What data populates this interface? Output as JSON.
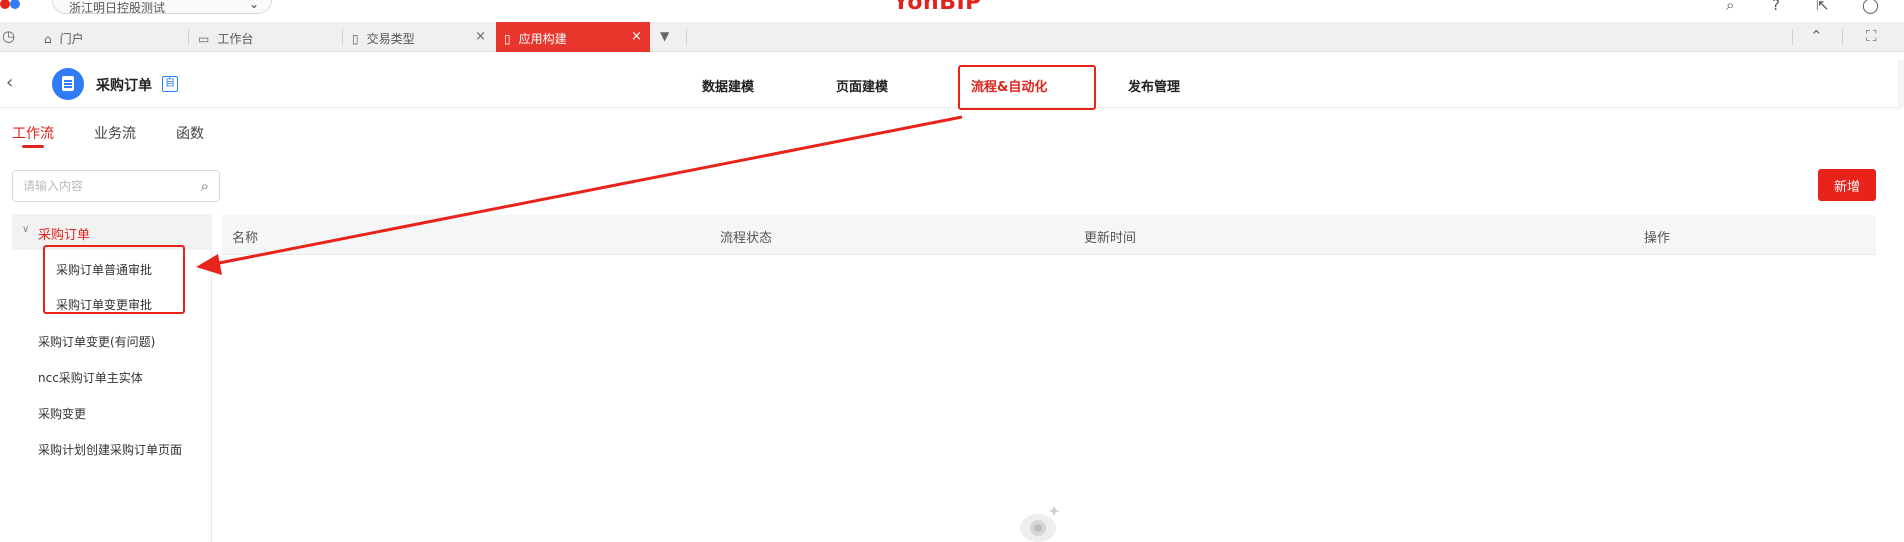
{
  "topbar": {
    "org_selector": "浙江明日控股测试",
    "brand": "YonBIP"
  },
  "tabs": [
    {
      "label": "门户",
      "icon": "home-icon",
      "closable": false,
      "active": false
    },
    {
      "label": "工作台",
      "icon": "monitor-icon",
      "closable": false,
      "active": false
    },
    {
      "label": "交易类型",
      "icon": "document-icon",
      "closable": true,
      "active": false
    },
    {
      "label": "应用构建",
      "icon": "document-icon",
      "closable": true,
      "active": true
    }
  ],
  "app_header": {
    "app_name": "采购订单",
    "badge": "自",
    "nav": [
      "数据建模",
      "页面建模",
      "流程&自动化",
      "发布管理"
    ],
    "active_nav": "流程&自动化"
  },
  "sub_tabs": [
    "工作流",
    "业务流",
    "函数"
  ],
  "search": {
    "placeholder": "请输入内容"
  },
  "tree": {
    "root": "采购订单",
    "children": [
      "采购订单普通审批",
      "采购订单变更审批"
    ],
    "items": [
      "采购订单变更(有问题)",
      "ncc采购订单主实体",
      "采购变更",
      "采购计划创建采购订单页面"
    ]
  },
  "add_button": "新增",
  "table": {
    "columns": [
      "名称",
      "流程状态",
      "更新时间",
      "操作"
    ]
  },
  "colors": {
    "accent": "#e0241c",
    "annotation": "#e8231b",
    "app_icon": "#2f7cf6"
  }
}
